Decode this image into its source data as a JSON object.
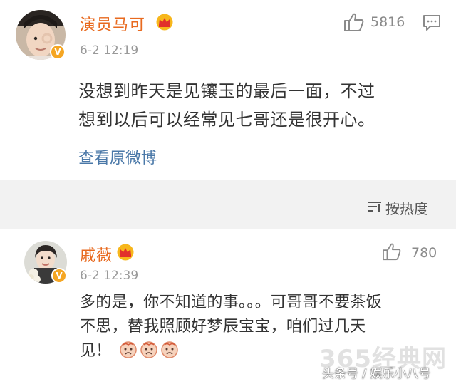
{
  "post": {
    "author": "演员马可",
    "time": "6-2 12:19",
    "likes": "5816",
    "text_lines": [
      "没想到昨天是见镶玉的最后一面，不过",
      "想到以后可以经常见七哥还是很开心。"
    ],
    "view_original_label": "查看原微博"
  },
  "sort": {
    "label": "按热度"
  },
  "comment": {
    "author": "戚薇",
    "time": "6-2 12:39",
    "likes": "780",
    "text_lines": [
      "多的是，你不知道的事。。。可哥哥不要茶饭",
      "不思，替我照顾好梦辰宝宝，咱们过几天",
      "见！"
    ],
    "emoji_count": 3
  },
  "watermark": {
    "site": "365经典网",
    "source": "头条号 / 娱乐小八号"
  },
  "colors": {
    "name": "#e86a1f",
    "link": "#4a78a8",
    "badge": "#f5a623",
    "separator": "#f2f2f2"
  },
  "icons": {
    "verified": "verified-v-icon",
    "crown": "vip-crown-icon",
    "like": "thumbs-up-icon",
    "comment": "comment-bubble-icon",
    "sort": "sort-lines-icon",
    "emoji": "sad-face-emoji-icon"
  }
}
